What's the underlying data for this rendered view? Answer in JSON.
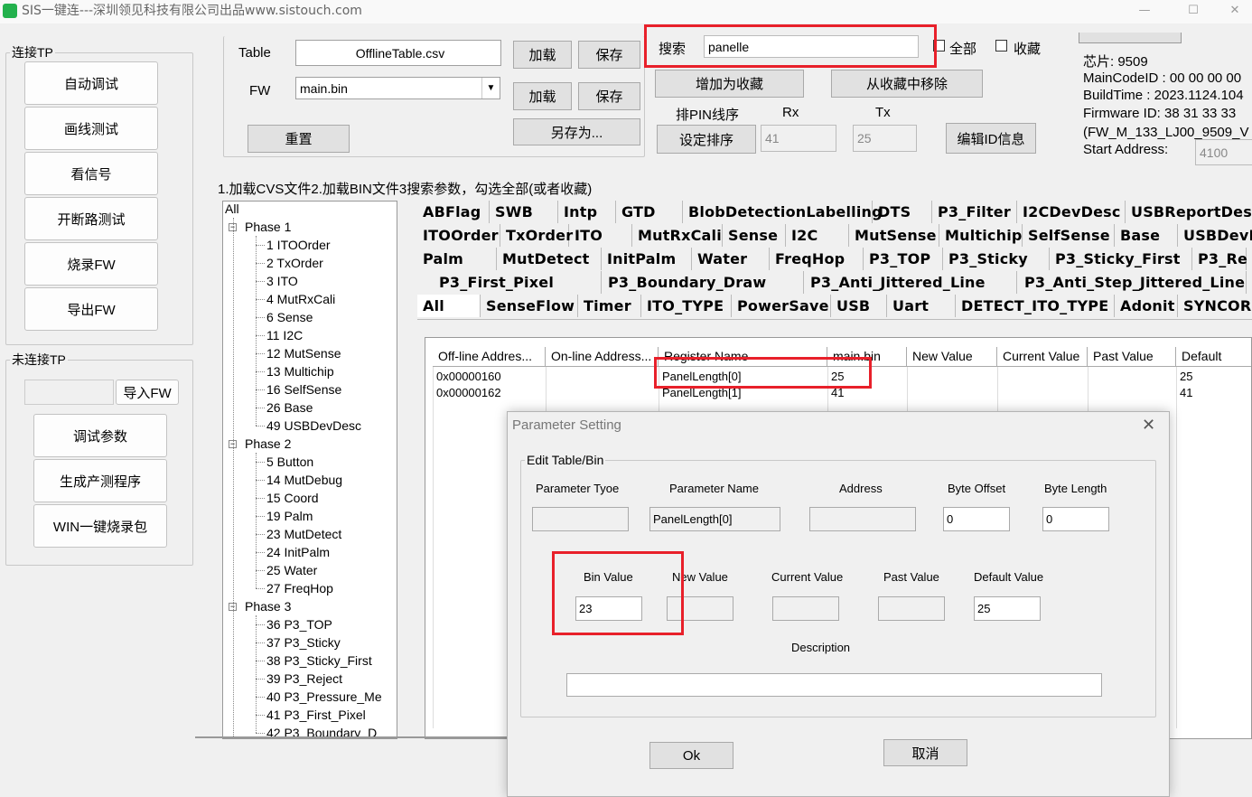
{
  "window": {
    "title": "SIS一键连---深圳领见科技有限公司出品www.sistouch.com"
  },
  "left_panel": {
    "connect_group": "连接TP",
    "connect_buttons": [
      "自动调试",
      "画线测试",
      "看信号",
      "开断路测试",
      "烧录FW",
      "导出FW"
    ],
    "disconnect_group": "未连接TP",
    "import_fw": "导入FW",
    "offline_buttons": [
      "调试参数",
      "生成产测程序",
      "WIN一键烧录包"
    ]
  },
  "file_panel": {
    "table_label": "Table",
    "table_value": "OfflineTable.csv",
    "fw_label": "FW",
    "fw_value": "main.bin",
    "load1": "加载",
    "save1": "保存",
    "load2": "加载",
    "save2": "保存",
    "save_as": "另存为...",
    "reset": "重置"
  },
  "search_panel": {
    "search_label": "搜索",
    "search_value": "panelle",
    "all_label": "全部",
    "fav_label": "收藏",
    "add_fav": "增加为收藏",
    "remove_fav": "从收藏中移除",
    "pin_sort_label": "排PIN线序",
    "rx_label": "Rx",
    "tx_label": "Tx",
    "set_sort": "设定排序",
    "rx_value": "41",
    "tx_value": "25",
    "edit_id": "编辑ID信息"
  },
  "chip_info": {
    "chip": "芯片:   9509",
    "main_code": "MainCodeID : 00 00 00 00",
    "build_time": "BuildTime : 2023.1124.104",
    "firmware_id": "Firmware ID: 38 31 33 33",
    "fw_name": "(FW_M_133_LJ00_9509_V",
    "start_address_label": "Start Address:",
    "start_address": "4100"
  },
  "instruction": "1.加载CVS文件2.加载BIN文件3搜索参数，勾选全部(或者收藏)",
  "tree": {
    "root": "All",
    "phases": [
      {
        "label": "Phase 1",
        "items": [
          "1 ITOOrder",
          "2 TxOrder",
          "3 ITO",
          "4 MutRxCali",
          "6 Sense",
          "11 I2C",
          "12 MutSense",
          "13 Multichip",
          "16 SelfSense",
          "26 Base",
          "49 USBDevDesc"
        ]
      },
      {
        "label": "Phase 2",
        "items": [
          "5 Button",
          "14 MutDebug",
          "15 Coord",
          "19 Palm",
          "23 MutDetect",
          "24 InitPalm",
          "25 Water",
          "27 FreqHop"
        ]
      },
      {
        "label": "Phase 3",
        "items": [
          "36 P3_TOP",
          "37 P3_Sticky",
          "38 P3_Sticky_First",
          "39 P3_Reject",
          "40 P3_Pressure_Me",
          "41 P3_First_Pixel",
          "42 P3_Boundary_D"
        ]
      }
    ]
  },
  "tabs": [
    [
      "ABFlag",
      "SWB",
      "Intp",
      "GTD",
      "BlobDetectionLabelling",
      "DTS",
      "P3_Filter",
      "I2CDevDesc",
      "USBReportDes"
    ],
    [
      "ITOOrder",
      "TxOrder",
      "ITO",
      "MutRxCali",
      "Sense",
      "I2C",
      "MutSense",
      "Multichip",
      "SelfSense",
      "Base",
      "USBDevD"
    ],
    [
      "Palm",
      "MutDetect",
      "InitPalm",
      "Water",
      "FreqHop",
      "P3_TOP",
      "P3_Sticky",
      "P3_Sticky_First",
      "P3_Re"
    ],
    [
      "P3_First_Pixel",
      "P3_Boundary_Draw",
      "P3_Anti_Jittered_Line",
      "P3_Anti_Step_Jittered_Line"
    ],
    [
      "All",
      "SenseFlow",
      "Timer",
      "ITO_TYPE",
      "PowerSave",
      "USB",
      "Uart",
      "DETECT_ITO_TYPE",
      "Adonit",
      "SYNCORI"
    ]
  ],
  "grid": {
    "headers": [
      "Off-line Addres...",
      "On-line Address...",
      "Register Name",
      "main.bin",
      "New Value",
      "Current Value",
      "Past Value",
      "Default"
    ],
    "rows": [
      [
        "0x00000160",
        "",
        "PanelLength[0]",
        "25",
        "",
        "",
        "",
        "25"
      ],
      [
        "0x00000162",
        "",
        "PanelLength[1]",
        "41",
        "",
        "",
        "",
        "41"
      ]
    ]
  },
  "dialog": {
    "title": "Parameter Setting",
    "group": "Edit Table/Bin",
    "labels1": [
      "Parameter Tyoe",
      "Parameter Name",
      "Address",
      "Byte Offset",
      "Byte Length"
    ],
    "values1": [
      "",
      "PanelLength[0]",
      "",
      "0",
      "0"
    ],
    "labels2": [
      "Bin Value",
      "New Value",
      "Current Value",
      "Past Value",
      "Default Value"
    ],
    "values2": [
      "23",
      "",
      "",
      "",
      "25"
    ],
    "description_label": "Description",
    "description_value": "",
    "ok": "Ok",
    "cancel": "取消"
  },
  "colors": {
    "highlight": "#e8202a",
    "app_icon": "#23b14d"
  }
}
